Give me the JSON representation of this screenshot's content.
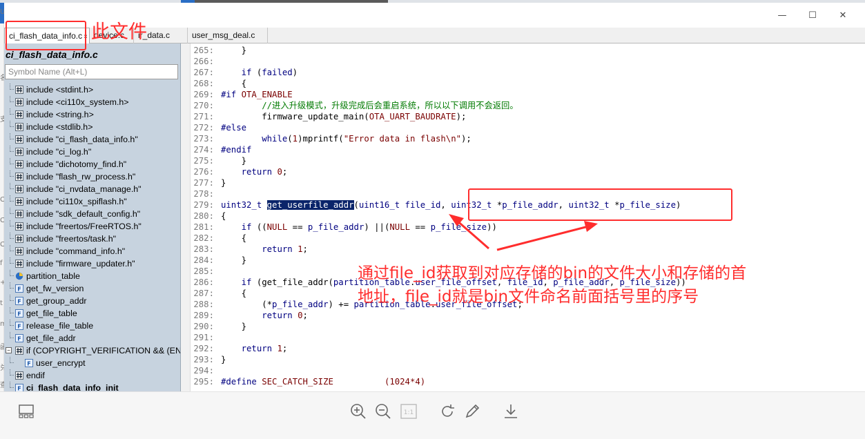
{
  "window": {
    "minimize_glyph": "—",
    "maximize_glyph": "☐",
    "close_glyph": "✕"
  },
  "left_strip": {
    "glyphs": [
      "U",
      "名",
      "支",
      "C",
      "C",
      "C",
      "f",
      "+",
      "t",
      "m",
      "函",
      "兑",
      "查",
      "景",
      "晨"
    ]
  },
  "tabs": [
    {
      "label": "ci_flash_data_info.c",
      "close": "×",
      "active": true
    },
    {
      "label": "device.c",
      "active": false
    },
    {
      "label": "ir_data.c",
      "active": false
    },
    {
      "label": "user_msg_deal.c",
      "active": false
    }
  ],
  "symbol_panel": {
    "title": "ci_flash_data_info.c",
    "search_placeholder": "Symbol Name (Alt+L)",
    "items": [
      {
        "label": "include <stdint.h>",
        "icon": "include"
      },
      {
        "label": "include <ci110x_system.h>",
        "icon": "include"
      },
      {
        "label": "include <string.h>",
        "icon": "include"
      },
      {
        "label": "include <stdlib.h>",
        "icon": "include"
      },
      {
        "label": "include \"ci_flash_data_info.h\"",
        "icon": "include"
      },
      {
        "label": "include \"ci_log.h\"",
        "icon": "include"
      },
      {
        "label": "include \"dichotomy_find.h\"",
        "icon": "include"
      },
      {
        "label": "include \"flash_rw_process.h\"",
        "icon": "include"
      },
      {
        "label": "include \"ci_nvdata_manage.h\"",
        "icon": "include"
      },
      {
        "label": "include \"ci110x_spiflash.h\"",
        "icon": "include"
      },
      {
        "label": "include \"sdk_default_config.h\"",
        "icon": "include"
      },
      {
        "label": "include \"freertos/FreeRTOS.h\"",
        "icon": "include"
      },
      {
        "label": "include \"freertos/task.h\"",
        "icon": "include"
      },
      {
        "label": "include \"command_info.h\"",
        "icon": "include"
      },
      {
        "label": "include \"firmware_updater.h\"",
        "icon": "include"
      },
      {
        "label": "partition_table",
        "icon": "variable"
      },
      {
        "label": "get_fw_version",
        "icon": "function"
      },
      {
        "label": "get_group_addr",
        "icon": "function"
      },
      {
        "label": "get_file_table",
        "icon": "function"
      },
      {
        "label": "release_file_table",
        "icon": "function"
      },
      {
        "label": "get_file_addr",
        "icon": "function"
      },
      {
        "label": "if (COPYRIGHT_VERIFICATION && (EN",
        "icon": "include",
        "expander": "−"
      },
      {
        "label": "user_encrypt",
        "icon": "function",
        "indent": true
      },
      {
        "label": "endif",
        "icon": "include"
      },
      {
        "label": "ci_flash_data_info_init",
        "icon": "function",
        "bold": true
      }
    ]
  },
  "code": {
    "lines": [
      {
        "n": "265:",
        "t": "    }"
      },
      {
        "n": "266:",
        "t": ""
      },
      {
        "n": "267:",
        "t": "    if (failed)"
      },
      {
        "n": "268:",
        "t": "    {"
      },
      {
        "n": "269:",
        "t": "#if OTA_ENABLE"
      },
      {
        "n": "270:",
        "t": "        //进入升级模式，升级完成后会重启系统，所以以下调用不会返回。"
      },
      {
        "n": "271:",
        "t": "        firmware_update_main(OTA_UART_BAUDRATE);"
      },
      {
        "n": "272:",
        "t": "#else"
      },
      {
        "n": "273:",
        "t": "        while(1)mprintf(\"Error data in flash\\n\");"
      },
      {
        "n": "274:",
        "t": "#endif"
      },
      {
        "n": "275:",
        "t": "    }"
      },
      {
        "n": "276:",
        "t": "    return 0;"
      },
      {
        "n": "277:",
        "t": "}"
      },
      {
        "n": "278:",
        "t": ""
      },
      {
        "n": "279:",
        "t": "uint32_t get_userfile_addr(uint16_t file_id, uint32_t *p_file_addr, uint32_t *p_file_size)"
      },
      {
        "n": "280:",
        "t": "{"
      },
      {
        "n": "281:",
        "t": "    if ((NULL == p_file_addr) ||(NULL == p_file_size))"
      },
      {
        "n": "282:",
        "t": "    {"
      },
      {
        "n": "283:",
        "t": "        return 1;"
      },
      {
        "n": "284:",
        "t": "    }"
      },
      {
        "n": "285:",
        "t": ""
      },
      {
        "n": "286:",
        "t": "    if (get_file_addr(partition_table.user_file_offset, file_id, p_file_addr, p_file_size))"
      },
      {
        "n": "287:",
        "t": "    {"
      },
      {
        "n": "288:",
        "t": "        (*p_file_addr) += partition_table.user_file_offset;"
      },
      {
        "n": "289:",
        "t": "        return 0;"
      },
      {
        "n": "290:",
        "t": "    }"
      },
      {
        "n": "291:",
        "t": ""
      },
      {
        "n": "292:",
        "t": "    return 1;"
      },
      {
        "n": "293:",
        "t": "}"
      },
      {
        "n": "294:",
        "t": ""
      },
      {
        "n": "295:",
        "t": "#define SEC_CATCH_SIZE          (1024*4)"
      }
    ]
  },
  "annotations": {
    "file_label": "此文件",
    "explain_line1": "通过file_id获取到对应存储的bin的文件大小和存储的首",
    "explain_line2": "地址，file_id就是bin文件命名前面括号里的序号",
    "color": "#ff2d2d"
  },
  "toolbar": {
    "icons": [
      "layout-icon",
      "zoom-in-icon",
      "zoom-out-icon",
      "actual-size-icon",
      "rotate-icon",
      "edit-icon",
      "download-icon"
    ],
    "actual_size_label": "1:1"
  }
}
